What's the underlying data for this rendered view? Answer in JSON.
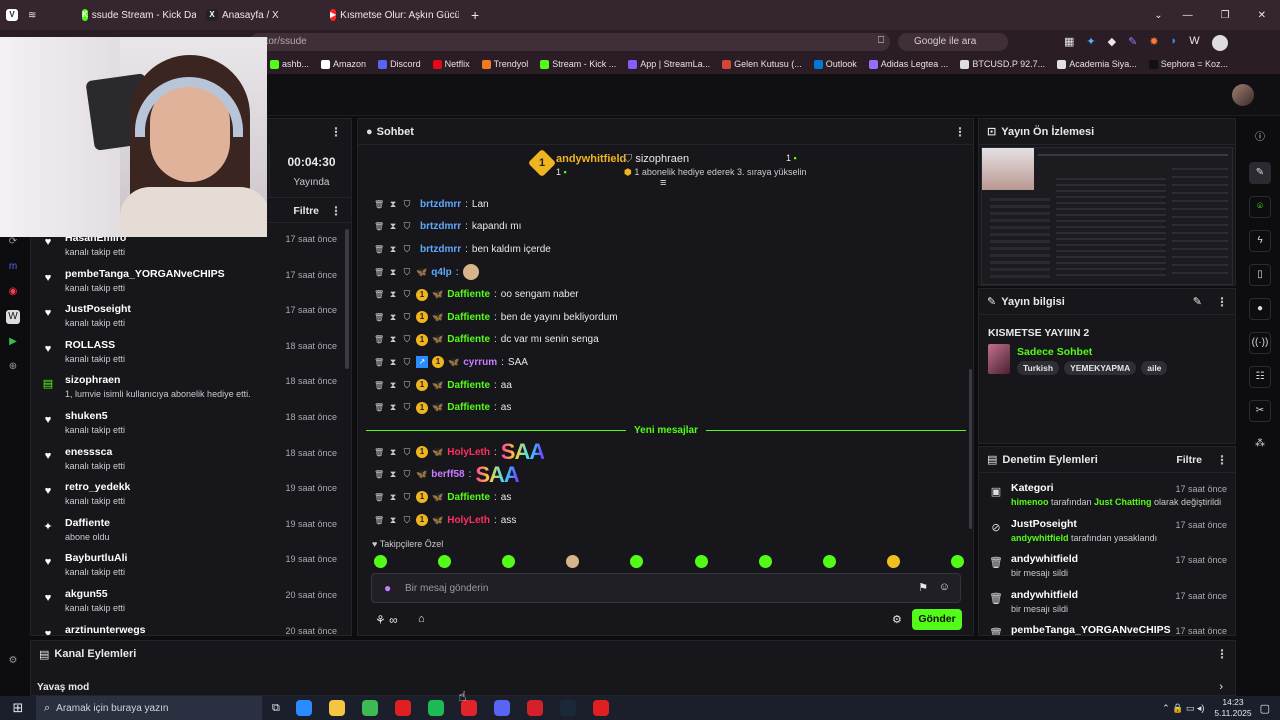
{
  "browser": {
    "tabs": [
      {
        "label": "ssude Stream - Kick Dashbo",
        "fav_letter": "K",
        "fav_color": "#53fc18"
      },
      {
        "label": "Anasayfa / X",
        "fav_letter": "X",
        "fav_color": "#222222"
      },
      {
        "label": "Kısmetse Olur: Aşkın Gücü",
        "fav_letter": "▶",
        "fav_color": "#ff2020"
      }
    ],
    "new_tab": "+",
    "address": "ator/ssude",
    "search_placeholder": "Google ile ara",
    "bookmarks": [
      {
        "label": "ashb...",
        "color": "#53fc18"
      },
      {
        "label": "Amazon",
        "color": "#ffffff"
      },
      {
        "label": "Discord",
        "color": "#5865f2"
      },
      {
        "label": "Netflix",
        "color": "#e50914"
      },
      {
        "label": "Trendyol",
        "color": "#f27a1a"
      },
      {
        "label": "Stream - Kick ...",
        "color": "#53fc18"
      },
      {
        "label": "App | StreamLa...",
        "color": "#8a5cff"
      },
      {
        "label": "Gelen Kutusu (...",
        "color": "#d44638"
      },
      {
        "label": "Outlook",
        "color": "#0078d4"
      },
      {
        "label": "Adidas Legtea ...",
        "color": "#9a6bff"
      },
      {
        "label": "BTCUSD.P 92.7...",
        "color": "#dddddd"
      },
      {
        "label": "Academia Siya...",
        "color": "#e0e0e0"
      },
      {
        "label": "Sephora = Koz...",
        "color": "#111111"
      }
    ]
  },
  "activity": {
    "timer": "00:04:30",
    "live_label": "Yayında",
    "filter_label": "Filtre",
    "items": [
      {
        "name": "HasanEmiro",
        "sub": "kanalı takip etti",
        "time": "17 saat önce",
        "icon": "♥"
      },
      {
        "name": "pembeTanga_YORGANveCHIPS",
        "sub": "kanalı takip etti",
        "time": "17 saat önce",
        "icon": "♥"
      },
      {
        "name": "JustPoseight",
        "sub": "kanalı takip etti",
        "time": "17 saat önce",
        "icon": "♥"
      },
      {
        "name": "ROLLASS",
        "sub": "kanalı takip etti",
        "time": "18 saat önce",
        "icon": "♥"
      },
      {
        "name": "sizophraen",
        "sub": "1, lumvie isimli kullanıcıya abonelik hediye etti.",
        "time": "18 saat önce",
        "icon": "▤"
      },
      {
        "name": "shuken5",
        "sub": "kanalı takip etti",
        "time": "18 saat önce",
        "icon": "♥"
      },
      {
        "name": "enesssca",
        "sub": "kanalı takip etti",
        "time": "18 saat önce",
        "icon": "♥"
      },
      {
        "name": "retro_yedekk",
        "sub": "kanalı takip etti",
        "time": "19 saat önce",
        "icon": "♥"
      },
      {
        "name": "Daffiente",
        "sub": "abone oldu",
        "time": "19 saat önce",
        "icon": "✦"
      },
      {
        "name": "BayburtluAli",
        "sub": "kanalı takip etti",
        "time": "19 saat önce",
        "icon": "♥"
      },
      {
        "name": "akgun55",
        "sub": "kanalı takip etti",
        "time": "20 saat önce",
        "icon": "♥"
      },
      {
        "name": "arztinunterwegs",
        "sub": "",
        "time": "20 saat önce",
        "icon": "♥"
      }
    ]
  },
  "chat": {
    "title": "Sohbet",
    "pinned": {
      "top_user": "andywhitfield",
      "top_count": "1",
      "second_user": "sizophraen",
      "second_count": "1",
      "gift_text": "1 abonelik hediye ederek 3. sıraya yükselin"
    },
    "messages": [
      {
        "user": "brtzdmrr",
        "text": "Lan",
        "color": "#5fa8ff",
        "sub": false,
        "emote": false
      },
      {
        "user": "brtzdmrr",
        "text": "kapandı mı",
        "color": "#5fa8ff",
        "sub": false,
        "emote": false
      },
      {
        "user": "brtzdmrr",
        "text": "ben kaldım içerde",
        "color": "#5fa8ff",
        "sub": false,
        "emote": false
      },
      {
        "user": "q4lp",
        "text": "",
        "color": "#5fa8ff",
        "sub": false,
        "emote": false
      },
      {
        "user": "Daffiente",
        "text": "oo sengam naber",
        "color": "#53fc18",
        "sub": true,
        "emote": false
      },
      {
        "user": "Daffiente",
        "text": "ben de yayını bekliyordum",
        "color": "#53fc18",
        "sub": true,
        "emote": false
      },
      {
        "user": "Daffiente",
        "text": "dc var mı senin senga",
        "color": "#53fc18",
        "sub": true,
        "emote": false
      },
      {
        "user": "cyrrum",
        "text": "SAA",
        "color": "#c77dff",
        "sub": true,
        "emote": false
      },
      {
        "user": "Daffiente",
        "text": "aa",
        "color": "#53fc18",
        "sub": true,
        "emote": false
      },
      {
        "user": "Daffiente",
        "text": "as",
        "color": "#53fc18",
        "sub": true,
        "emote": false
      }
    ],
    "new_messages_label": "Yeni mesajlar",
    "new_messages": [
      {
        "user": "HolyLeth",
        "text": "SAA",
        "color": "#ff2f5f",
        "sub": true,
        "emote": true
      },
      {
        "user": "berff58",
        "text": "SAA",
        "color": "#c77dff",
        "sub": false,
        "emote": true
      },
      {
        "user": "Daffiente",
        "text": "as",
        "color": "#53fc18",
        "sub": true,
        "emote": false
      },
      {
        "user": "HolyLeth",
        "text": "ass",
        "color": "#ff2f5f",
        "sub": true,
        "emote": false
      }
    ],
    "followers_only": "Takipçilere Özel",
    "emoji_colors": [
      "#53fc18",
      "#53fc18",
      "#53fc18",
      "#d8b48a",
      "#53fc18",
      "#53fc18",
      "#53fc18",
      "#53fc18",
      "#f0c020",
      "#53fc18"
    ],
    "input_placeholder": "Bir mesaj gönderin",
    "send_label": "Gönder"
  },
  "preview": {
    "title": "Yayın Ön İzlemesi"
  },
  "stream_info": {
    "title": "Yayın bilgisi",
    "stream_title": "KISMETSE YAYIIIN 2",
    "category": "Sadece Sohbet",
    "tags": [
      "Turkish",
      "YEMEKYAPMA",
      "aile"
    ]
  },
  "mod_log": {
    "title": "Denetim Eylemleri",
    "filter_label": "Filtre",
    "items": [
      {
        "title": "Kategori",
        "actor": "himenoo",
        "mid": " tarafından ",
        "hl": "Just Chatting",
        "tail": " olarak değiştirildi",
        "time": "17 saat önce",
        "icon": "▣"
      },
      {
        "title": "JustPoseight",
        "actor": "andywhitfield",
        "mid": " tarafından yasaklandı",
        "hl": "",
        "tail": "",
        "time": "17 saat önce",
        "icon": "⊘"
      },
      {
        "title": "andywhitfield",
        "actor": "",
        "mid": "bir mesajı sildi",
        "hl": "",
        "tail": "",
        "time": "17 saat önce",
        "icon": "🗑"
      },
      {
        "title": "andywhitfield",
        "actor": "",
        "mid": "bir mesajı sildi",
        "hl": "",
        "tail": "",
        "time": "17 saat önce",
        "icon": "🗑"
      },
      {
        "title": "pembeTanga_YORGANveCHIPS",
        "actor": "",
        "mid": "",
        "hl": "",
        "tail": "",
        "time": "17 saat önce",
        "icon": "🗑"
      }
    ]
  },
  "channel_actions": {
    "title": "Kanal Eylemleri",
    "slow_mode": "Yavaş mod"
  },
  "taskbar": {
    "search_placeholder": "Aramak için buraya yazın",
    "time": "14:23",
    "date": "5.11.2025",
    "apps": [
      "#2b8cff",
      "#f5c542",
      "#3cba54",
      "#e02020",
      "#1db954",
      "#e0242a",
      "#5865f2",
      "#d4202a",
      "#1b2838",
      "#e02020"
    ]
  },
  "webcam": {
    "present": true
  }
}
